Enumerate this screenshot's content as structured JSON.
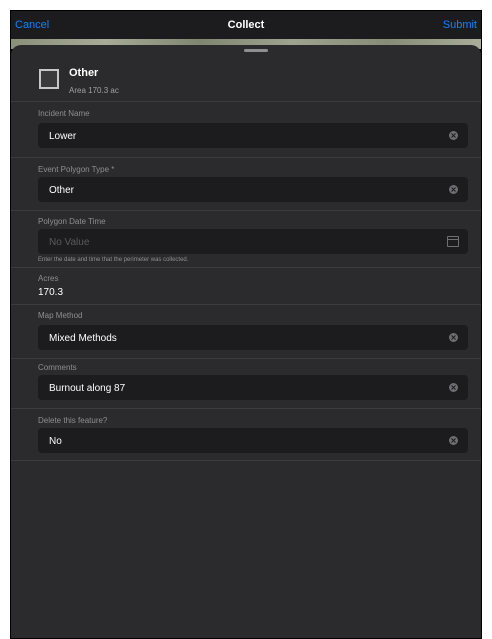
{
  "navbar": {
    "cancel_label": "Cancel",
    "title": "Collect",
    "submit_label": "Submit"
  },
  "feature": {
    "title": "Other",
    "subtitle": "Area 170.3 ac"
  },
  "fields": {
    "incident_name": {
      "label": "Incident Name",
      "value": "Lower"
    },
    "event_polygon_type": {
      "label": "Event Polygon Type *",
      "value": "Other"
    },
    "polygon_date_time": {
      "label": "Polygon Date Time",
      "placeholder": "No Value",
      "hint": "Enter the date and time that the perimeter was collected."
    },
    "acres": {
      "label": "Acres",
      "value": "170.3"
    },
    "map_method": {
      "label": "Map Method",
      "value": "Mixed Methods"
    },
    "comments": {
      "label": "Comments",
      "value": "Burnout along 87"
    },
    "delete_feature": {
      "label": "Delete this feature?",
      "value": "No"
    }
  },
  "colors": {
    "accent": "#0a84ff",
    "sheet_background": "#2b2b2d",
    "field_background": "#1c1c1e",
    "label": "#8e8e93"
  },
  "icons": {
    "clear": "clear-circle-x-icon",
    "calendar": "calendar-icon"
  }
}
